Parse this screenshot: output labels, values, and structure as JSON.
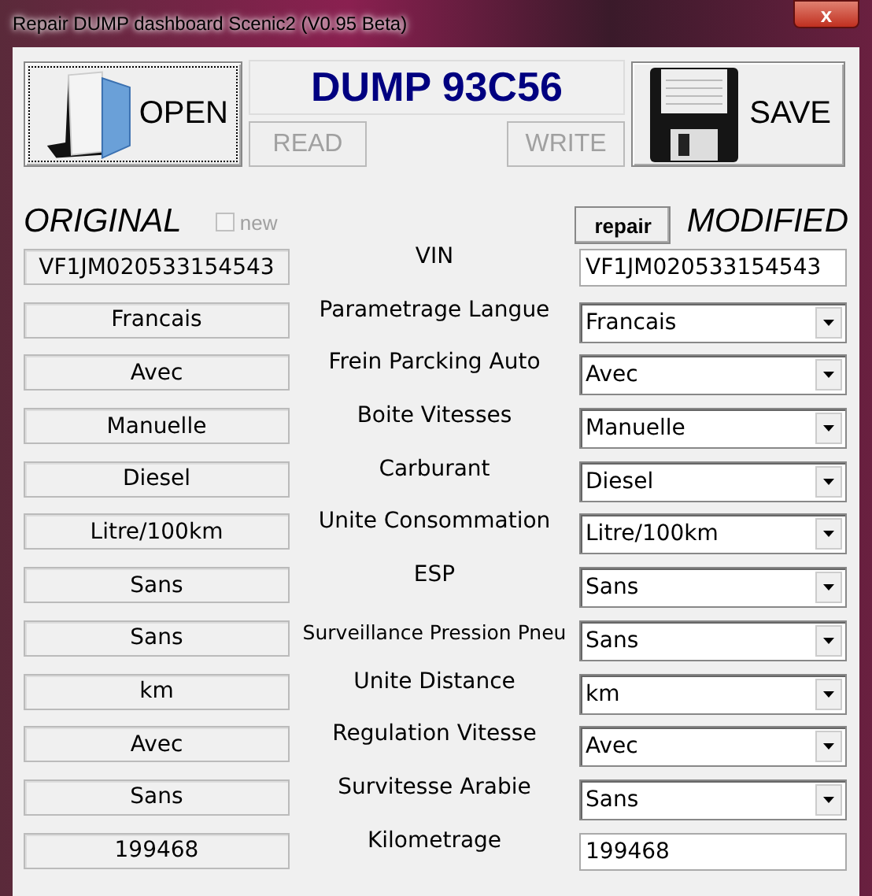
{
  "window": {
    "title": "Repair DUMP dashboard Scenic2 (V0.95 Beta)",
    "close": "x"
  },
  "toolbar": {
    "open_button": "OPEN",
    "dump_title": "DUMP 93C56",
    "read_button": {
      "label": "READ",
      "disabled": true
    },
    "write_button": {
      "label": "WRITE",
      "disabled": true
    },
    "save_button": "SAVE"
  },
  "headers": {
    "original": "ORIGINAL",
    "new_checkbox": {
      "label": "new",
      "checked": false,
      "disabled": true
    },
    "repair_button": "repair",
    "modified": "MODIFIED"
  },
  "rows": [
    {
      "label": "VIN",
      "original": "VF1JM020533154543",
      "modified": "VF1JM020533154543",
      "kind": "text"
    },
    {
      "label": "Parametrage Langue",
      "original": "Francais",
      "modified": "Francais",
      "kind": "select"
    },
    {
      "label": "Frein Parcking Auto",
      "original": "Avec",
      "modified": "Avec",
      "kind": "select"
    },
    {
      "label": "Boite Vitesses",
      "original": "Manuelle",
      "modified": "Manuelle",
      "kind": "select"
    },
    {
      "label": "Carburant",
      "original": "Diesel",
      "modified": "Diesel",
      "kind": "select"
    },
    {
      "label": "Unite Consommation",
      "original": "Litre/100km",
      "modified": "Litre/100km",
      "kind": "select"
    },
    {
      "label": "ESP",
      "original": "Sans",
      "modified": "Sans",
      "kind": "select"
    },
    {
      "label": "Surveillance Pression Pneu",
      "original": "Sans",
      "modified": "Sans",
      "kind": "select"
    },
    {
      "label": "Unite Distance",
      "original": "km",
      "modified": "km",
      "kind": "select"
    },
    {
      "label": "Regulation Vitesse",
      "original": "Avec",
      "modified": "Avec",
      "kind": "select"
    },
    {
      "label": "Survitesse Arabie",
      "original": "Sans",
      "modified": "Sans",
      "kind": "select"
    },
    {
      "label": "Kilometrage",
      "original": "199468",
      "modified": "199468",
      "kind": "text"
    }
  ]
}
